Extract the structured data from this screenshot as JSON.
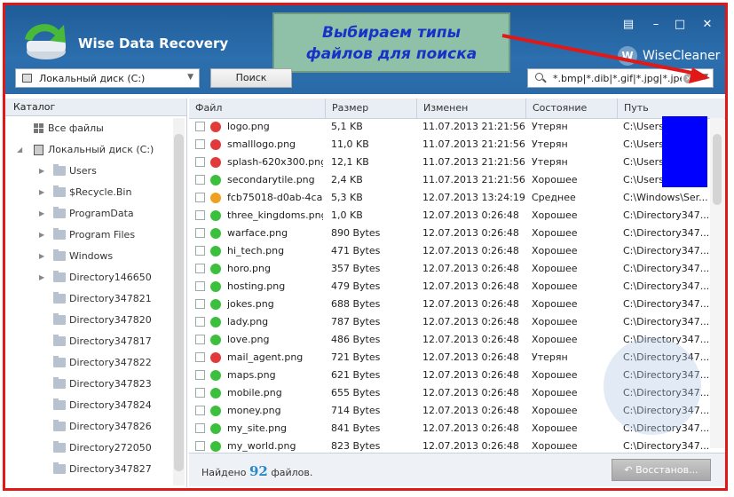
{
  "app": {
    "title": "Wise Data Recovery",
    "brand": "WiseCleaner",
    "brand_letter": "W"
  },
  "callout": {
    "line1": "Выбираем типы",
    "line2": "файлов для поиска"
  },
  "window_buttons": {
    "menu": "▤",
    "minimize": "–",
    "maximize": "□",
    "close": "✕"
  },
  "toolbar": {
    "drive": "Локальный диск (C:)",
    "search_label": "Поиск",
    "filter_value": "*.bmp|*.dib|*.gif|*.jpg|*.jpeg"
  },
  "catalog": {
    "header": "Каталог",
    "items": [
      {
        "label": "Все файлы",
        "level": 0,
        "icon": "grid-icon"
      },
      {
        "label": "Локальный диск (C:)",
        "level": 0,
        "icon": "hdd-icon",
        "expanded": true
      },
      {
        "label": "Users",
        "level": 1,
        "expandable": true
      },
      {
        "label": "$Recycle.Bin",
        "level": 1,
        "expandable": true
      },
      {
        "label": "ProgramData",
        "level": 1,
        "expandable": true
      },
      {
        "label": "Program Files",
        "level": 1,
        "expandable": true
      },
      {
        "label": "Windows",
        "level": 1,
        "expandable": true
      },
      {
        "label": "Directory146650",
        "level": 1,
        "expandable": true
      },
      {
        "label": "Directory347821",
        "level": 1
      },
      {
        "label": "Directory347820",
        "level": 1
      },
      {
        "label": "Directory347817",
        "level": 1
      },
      {
        "label": "Directory347822",
        "level": 1
      },
      {
        "label": "Directory347823",
        "level": 1
      },
      {
        "label": "Directory347824",
        "level": 1
      },
      {
        "label": "Directory347826",
        "level": 1
      },
      {
        "label": "Directory272050",
        "level": 1
      },
      {
        "label": "Directory347827",
        "level": 1
      }
    ]
  },
  "files": {
    "columns": [
      "Файл",
      "Размер",
      "Изменен",
      "Состояние",
      "Путь"
    ],
    "status_colors": {
      "lost": "#e03a3a",
      "good": "#3cbf3c",
      "medium": "#f0a020"
    },
    "rows": [
      {
        "name": "logo.png",
        "size": "5,1 KB",
        "modified": "11.07.2013 21:21:56",
        "state": "Утерян",
        "status": "lost",
        "path": "C:\\Users"
      },
      {
        "name": "smalllogo.png",
        "size": "11,0 KB",
        "modified": "11.07.2013 21:21:56",
        "state": "Утерян",
        "status": "lost",
        "path": "C:\\Users"
      },
      {
        "name": "splash-620x300.png",
        "size": "12,1 KB",
        "modified": "11.07.2013 21:21:56",
        "state": "Утерян",
        "status": "lost",
        "path": "C:\\Users"
      },
      {
        "name": "secondarytile.png",
        "size": "2,4 KB",
        "modified": "11.07.2013 21:21:56",
        "state": "Хорошее",
        "status": "good",
        "path": "C:\\Users"
      },
      {
        "name": "fcb75018-d0ab-4ca...",
        "size": "5,3 KB",
        "modified": "12.07.2013 13:24:19",
        "state": "Среднее",
        "status": "medium",
        "path": "C:\\Windows\\Ser..."
      },
      {
        "name": "three_kingdoms.png",
        "size": "1,0 KB",
        "modified": "12.07.2013 0:26:48",
        "state": "Хорошее",
        "status": "good",
        "path": "C:\\Directory347..."
      },
      {
        "name": "warface.png",
        "size": "890 Bytes",
        "modified": "12.07.2013 0:26:48",
        "state": "Хорошее",
        "status": "good",
        "path": "C:\\Directory347..."
      },
      {
        "name": "hi_tech.png",
        "size": "471 Bytes",
        "modified": "12.07.2013 0:26:48",
        "state": "Хорошее",
        "status": "good",
        "path": "C:\\Directory347..."
      },
      {
        "name": "horo.png",
        "size": "357 Bytes",
        "modified": "12.07.2013 0:26:48",
        "state": "Хорошее",
        "status": "good",
        "path": "C:\\Directory347..."
      },
      {
        "name": "hosting.png",
        "size": "479 Bytes",
        "modified": "12.07.2013 0:26:48",
        "state": "Хорошее",
        "status": "good",
        "path": "C:\\Directory347..."
      },
      {
        "name": "jokes.png",
        "size": "688 Bytes",
        "modified": "12.07.2013 0:26:48",
        "state": "Хорошее",
        "status": "good",
        "path": "C:\\Directory347..."
      },
      {
        "name": "lady.png",
        "size": "787 Bytes",
        "modified": "12.07.2013 0:26:48",
        "state": "Хорошее",
        "status": "good",
        "path": "C:\\Directory347..."
      },
      {
        "name": "love.png",
        "size": "486 Bytes",
        "modified": "12.07.2013 0:26:48",
        "state": "Хорошее",
        "status": "good",
        "path": "C:\\Directory347..."
      },
      {
        "name": "mail_agent.png",
        "size": "721 Bytes",
        "modified": "12.07.2013 0:26:48",
        "state": "Утерян",
        "status": "lost",
        "path": "C:\\Directory347..."
      },
      {
        "name": "maps.png",
        "size": "621 Bytes",
        "modified": "12.07.2013 0:26:48",
        "state": "Хорошее",
        "status": "good",
        "path": "C:\\Directory347..."
      },
      {
        "name": "mobile.png",
        "size": "655 Bytes",
        "modified": "12.07.2013 0:26:48",
        "state": "Хорошее",
        "status": "good",
        "path": "C:\\Directory347..."
      },
      {
        "name": "money.png",
        "size": "714 Bytes",
        "modified": "12.07.2013 0:26:48",
        "state": "Хорошее",
        "status": "good",
        "path": "C:\\Directory347..."
      },
      {
        "name": "my_site.png",
        "size": "841 Bytes",
        "modified": "12.07.2013 0:26:48",
        "state": "Хорошее",
        "status": "good",
        "path": "C:\\Directory347..."
      },
      {
        "name": "my_world.png",
        "size": "823 Bytes",
        "modified": "12.07.2013 0:26:48",
        "state": "Хорошее",
        "status": "good",
        "path": "C:\\Directory347..."
      }
    ]
  },
  "status_bar": {
    "prefix": "Найдено",
    "count": "92",
    "suffix": "файлов.",
    "restore_label": "Восстанов..."
  }
}
